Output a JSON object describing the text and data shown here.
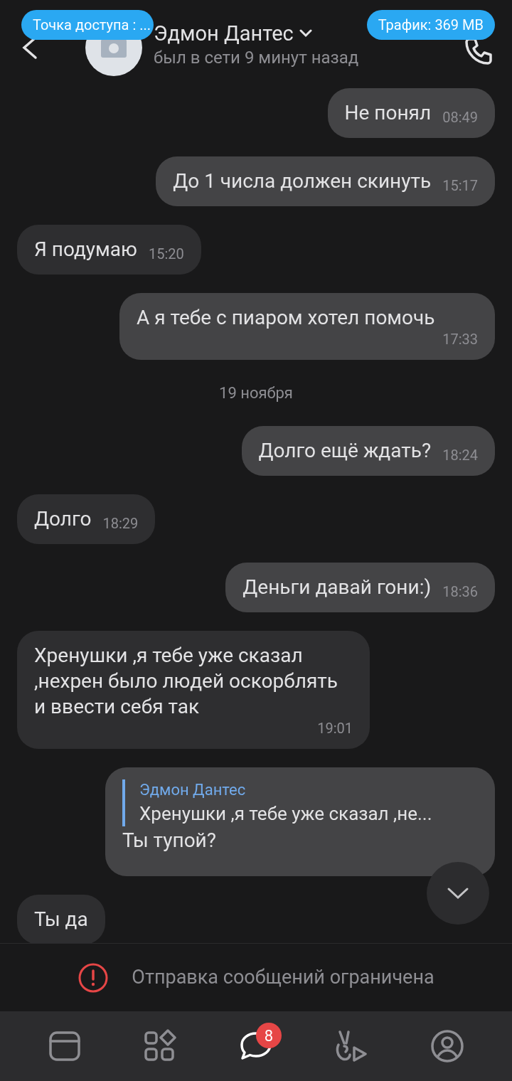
{
  "status_chips": [
    {
      "label": "Точка доступа : ..."
    },
    {
      "label": "Трафик: 369 MB"
    }
  ],
  "header": {
    "title": "Эдмон Дантес",
    "subtitle": "был в сети 9 минут назад"
  },
  "messages": [
    {
      "kind": "outgoing",
      "text": "Не понял",
      "time": "08:49"
    },
    {
      "kind": "outgoing",
      "text": "До 1 числа должен скинуть",
      "time": "15:17"
    },
    {
      "kind": "incoming",
      "text": "Я подумаю",
      "time": "15:20"
    },
    {
      "kind": "outgoing",
      "text": "А я тебе с пиаром хотел помочь",
      "time": "17:33"
    },
    {
      "kind": "date",
      "text": "19 ноября"
    },
    {
      "kind": "outgoing",
      "text": "Долго ещё ждать?",
      "time": "18:24"
    },
    {
      "kind": "incoming",
      "text": "Долго",
      "time": "18:29"
    },
    {
      "kind": "outgoing",
      "text": "Деньги давай гони:)",
      "time": "18:36"
    },
    {
      "kind": "incoming",
      "text": "Хренушки ,я тебе уже сказал ,нехрен было людей оскорблять и ввести себя так",
      "time": "19:01"
    },
    {
      "kind": "reply",
      "reply_author": "Эдмон Дантес",
      "reply_text": "Хренушки ,я тебе уже сказал ,не...",
      "text": "Ты тупой?"
    },
    {
      "kind": "incoming",
      "text": "Ты да"
    }
  ],
  "restriction": {
    "text": "Отправка сообщений ограничена"
  },
  "nav": [
    {
      "selected": false
    },
    {
      "selected": false
    },
    {
      "selected": true,
      "badge": "8"
    },
    {
      "selected": false
    },
    {
      "selected": false
    }
  ]
}
